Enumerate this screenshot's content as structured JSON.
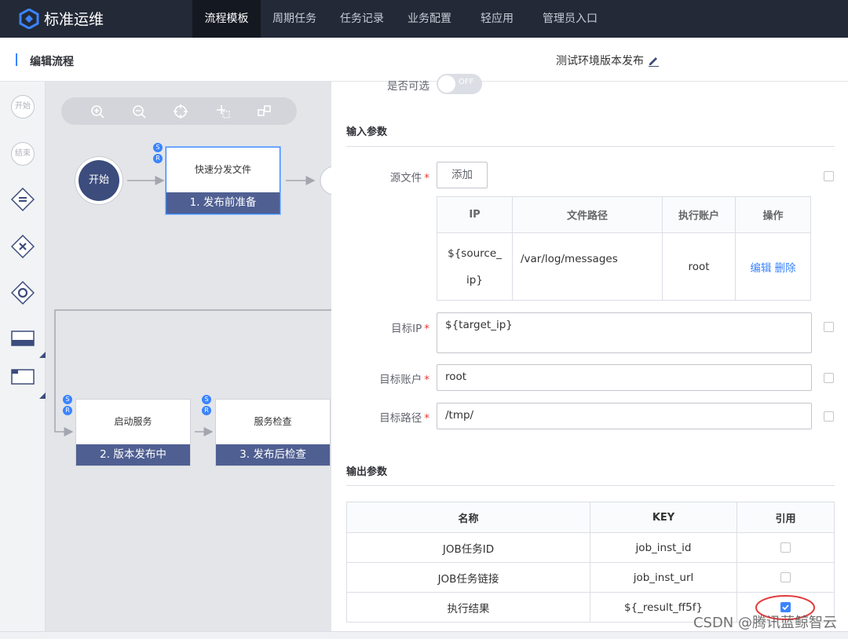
{
  "app": {
    "title": "标准运维"
  },
  "nav": {
    "items": [
      "流程模板",
      "周期任务",
      "任务记录",
      "业务配置",
      "轻应用",
      "管理员入口"
    ],
    "active": "流程模板"
  },
  "subheader": {
    "title": "编辑流程",
    "flow_name": "测试环境版本发布"
  },
  "palette": {
    "start": "开始",
    "end": "结束"
  },
  "canvas": {
    "start_label": "开始",
    "tasks": [
      {
        "name": "快速分发文件",
        "stage": "1. 发布前准备"
      },
      {
        "name": "启动服务",
        "stage": "2. 版本发布中"
      },
      {
        "name": "服务检查",
        "stage": "3. 发布后检查"
      }
    ],
    "badges": {
      "s": "S",
      "r": "R"
    }
  },
  "panel": {
    "optional_label": "是否可选",
    "toggle_text": "OFF",
    "input_section": "输入参数",
    "source_file_label": "源文件",
    "add_button": "添加",
    "source_table": {
      "headers": [
        "IP",
        "文件路径",
        "执行账户",
        "操作"
      ],
      "row": {
        "ip": "${source_ip}",
        "path": "/var/log/messages",
        "account": "root",
        "edit": "编辑",
        "delete": "删除"
      }
    },
    "target_ip_label": "目标IP",
    "target_ip_value": "${target_ip}",
    "target_account_label": "目标账户",
    "target_account_value": "root",
    "target_path_label": "目标路径",
    "target_path_value": "/tmp/",
    "output_section": "输出参数",
    "output_table": {
      "headers": [
        "名称",
        "KEY",
        "引用"
      ],
      "rows": [
        {
          "name": "JOB任务ID",
          "key": "job_inst_id",
          "checked": false
        },
        {
          "name": "JOB任务链接",
          "key": "job_inst_url",
          "checked": false
        },
        {
          "name": "执行结果",
          "key": "${_result_ff5f}",
          "checked": true
        }
      ]
    }
  },
  "watermark": "CSDN @腾讯蓝鲸智云",
  "colors": {
    "nav_bg": "#232936",
    "accent": "#3a84ff",
    "stage_bg": "#4f5f92",
    "start_node": "#3c4c7c"
  }
}
